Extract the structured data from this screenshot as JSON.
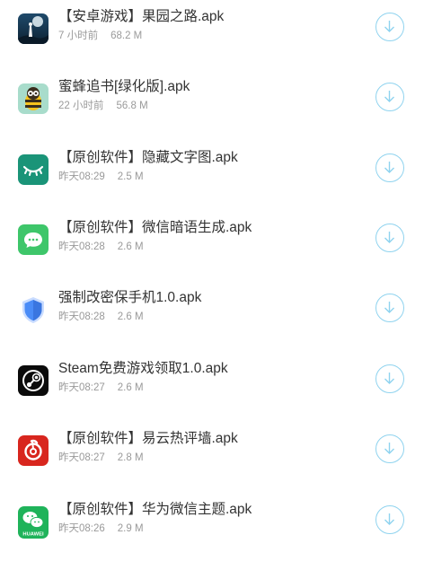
{
  "colors": {
    "accent": "#8fd3ef",
    "title_text": "#333333",
    "meta_text": "#9a9a9a"
  },
  "files": [
    {
      "name": "【安卓游戏】果园之路.apk",
      "time": "7 小时前",
      "size": "68.2 M",
      "icon": "orchard-road-app-icon"
    },
    {
      "name": "蜜蜂追书[绿化版].apk",
      "time": "22 小时前",
      "size": "56.8 M",
      "icon": "bee-reader-app-icon"
    },
    {
      "name": "【原创软件】隐藏文字图.apk",
      "time": "昨天08:29",
      "size": "2.5 M",
      "icon": "closed-eye-app-icon"
    },
    {
      "name": "【原创软件】微信暗语生成.apk",
      "time": "昨天08:28",
      "size": "2.6 M",
      "icon": "chat-bubble-app-icon"
    },
    {
      "name": "强制改密保手机1.0.apk",
      "time": "昨天08:28",
      "size": "2.6 M",
      "icon": "shield-app-icon"
    },
    {
      "name": "Steam免费游戏领取1.0.apk",
      "time": "昨天08:27",
      "size": "2.6 M",
      "icon": "steam-app-icon"
    },
    {
      "name": "【原创软件】易云热评墙.apk",
      "time": "昨天08:27",
      "size": "2.8 M",
      "icon": "netease-music-app-icon"
    },
    {
      "name": "【原创软件】华为微信主题.apk",
      "time": "昨天08:26",
      "size": "2.9 M",
      "icon": "huawei-wechat-app-icon",
      "icon_label": "HUAWEI"
    }
  ]
}
